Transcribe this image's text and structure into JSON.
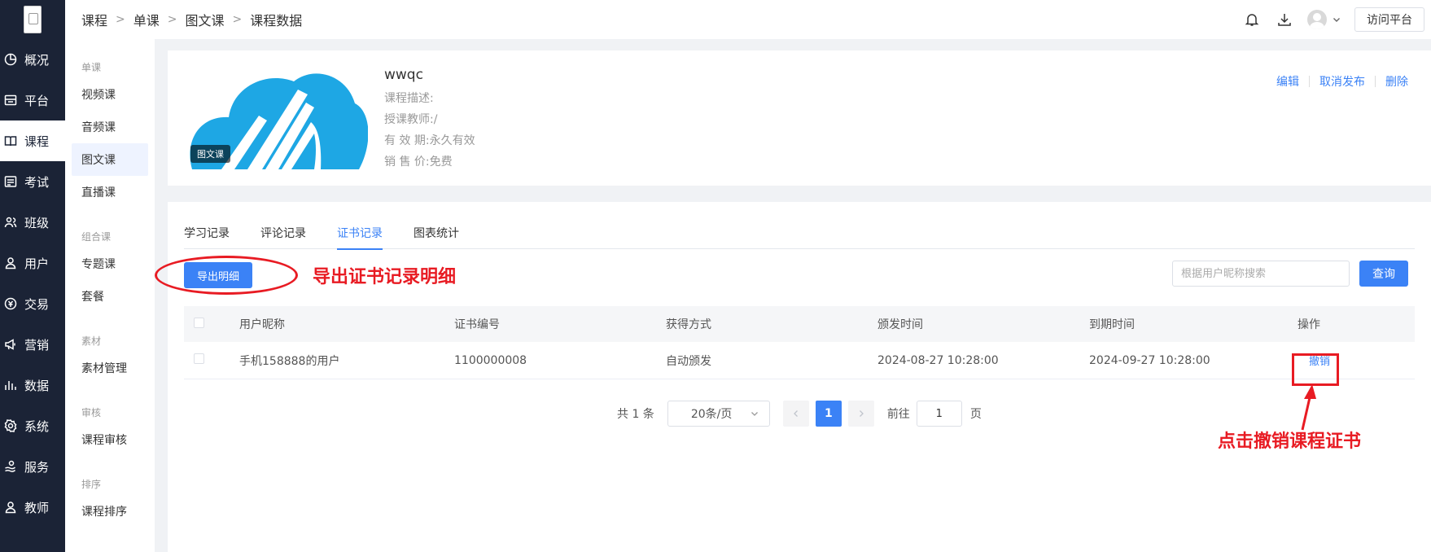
{
  "rail": {
    "items": [
      {
        "label": "概况",
        "icon": "dashboard-icon"
      },
      {
        "label": "平台",
        "icon": "platform-icon"
      },
      {
        "label": "课程",
        "icon": "book-icon",
        "active": true
      },
      {
        "label": "考试",
        "icon": "exam-icon"
      },
      {
        "label": "班级",
        "icon": "class-icon"
      },
      {
        "label": "用户",
        "icon": "user-icon"
      },
      {
        "label": "交易",
        "icon": "trade-icon"
      },
      {
        "label": "营销",
        "icon": "megaphone-icon"
      },
      {
        "label": "数据",
        "icon": "bar-chart-icon"
      },
      {
        "label": "系统",
        "icon": "gear-icon"
      },
      {
        "label": "服务",
        "icon": "service-icon"
      },
      {
        "label": "教师",
        "icon": "teacher-icon"
      }
    ]
  },
  "submenu": {
    "groups": [
      {
        "title": "单课",
        "items": [
          "视频课",
          "音频课",
          "图文课",
          "直播课"
        ]
      },
      {
        "title": "组合课",
        "items": [
          "专题课",
          "套餐"
        ]
      },
      {
        "title": "素材",
        "items": [
          "素材管理"
        ]
      },
      {
        "title": "审核",
        "items": [
          "课程审核"
        ]
      },
      {
        "title": "排序",
        "items": [
          "课程排序"
        ]
      }
    ],
    "active": "图文课"
  },
  "breadcrumb": [
    "课程",
    "单课",
    "图文课",
    "课程数据"
  ],
  "topbar": {
    "visit_label": "访问平台"
  },
  "course": {
    "title": "wwqc",
    "badge": "图文课",
    "desc_label": "课程描述:",
    "desc_value": "",
    "teacher_label": "授课教师:",
    "teacher_value": "/",
    "valid_label": "有 效 期:",
    "valid_value": "永久有效",
    "price_label": "销 售 价:",
    "price_value": "免费",
    "actions": [
      "编辑",
      "取消发布",
      "删除"
    ]
  },
  "tabs": [
    "学习记录",
    "评论记录",
    "证书记录",
    "图表统计"
  ],
  "active_tab": "证书记录",
  "toolbar": {
    "export_label": "导出明细",
    "search_placeholder": "根据用户昵称搜索",
    "query_label": "查询"
  },
  "table": {
    "headers": [
      "用户昵称",
      "证书编号",
      "获得方式",
      "颁发时间",
      "到期时间",
      "操作"
    ],
    "rows": [
      {
        "nickname": "手机158888的用户",
        "cert_no": "1100000008",
        "method": "自动颁发",
        "issued": "2024-08-27 10:28:00",
        "expires": "2024-09-27 10:28:00",
        "action": "撤销"
      }
    ]
  },
  "pagination": {
    "total_text": "共 1 条",
    "page_size": "20条/页",
    "current_page": "1",
    "goto_label": "前往",
    "goto_value": "1",
    "page_unit": "页"
  },
  "annotations": {
    "export_note": "导出证书记录明细",
    "revoke_note": "点击撤销课程证书",
    "color": "#e81b23"
  },
  "colors": {
    "accent": "#3b82f6",
    "rail_bg": "#1b2336"
  }
}
